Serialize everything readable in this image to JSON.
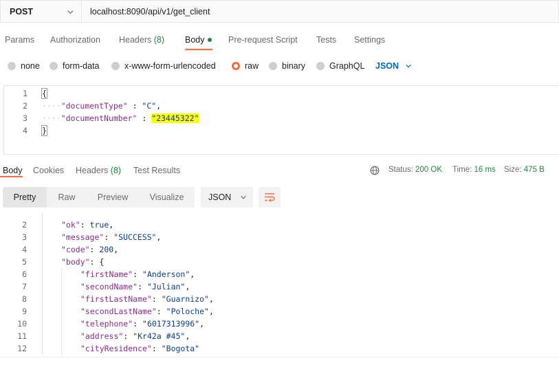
{
  "request": {
    "method": "POST",
    "url": "localhost:8090/api/v1/get_client"
  },
  "request_tabs": [
    {
      "label": "Params"
    },
    {
      "label": "Authorization"
    },
    {
      "label": "Headers",
      "count": "(8)"
    },
    {
      "label": "Body",
      "active": true
    },
    {
      "label": "Pre-request Script"
    },
    {
      "label": "Tests"
    },
    {
      "label": "Settings"
    }
  ],
  "body_types": [
    {
      "label": "none"
    },
    {
      "label": "form-data"
    },
    {
      "label": "x-www-form-urlencoded"
    },
    {
      "label": "raw",
      "checked": true
    },
    {
      "label": "binary"
    },
    {
      "label": "GraphQL"
    }
  ],
  "body_language": "JSON",
  "request_body": {
    "line_numbers": [
      "1",
      "2",
      "3",
      "4"
    ],
    "open": "{",
    "close": "}",
    "entries": [
      {
        "key": "\"documentType\"",
        "sep": " : ",
        "value": "\"C\"",
        "trail": ","
      },
      {
        "key": "\"documentNumber\"",
        "sep": " : ",
        "value": "\"23445322\"",
        "trail": ""
      }
    ]
  },
  "response_tabs": [
    {
      "label": "Body",
      "active": true
    },
    {
      "label": "Cookies"
    },
    {
      "label": "Headers",
      "count": "(8)"
    },
    {
      "label": "Test Results"
    }
  ],
  "response_status": {
    "status_label": "Status:",
    "status_value": "200 OK",
    "time_label": "Time:",
    "time_value": "16 ms",
    "size_label": "Size:",
    "size_value": "475 B"
  },
  "view_modes": [
    {
      "label": "Pretty",
      "active": true
    },
    {
      "label": "Raw"
    },
    {
      "label": "Preview"
    },
    {
      "label": "Visualize"
    }
  ],
  "response_format": "JSON",
  "response_body": {
    "lines": [
      {
        "n": "2",
        "indent": 1,
        "key": "\"ok\"",
        "value": "true",
        "vtype": "kw",
        "trail": ","
      },
      {
        "n": "3",
        "indent": 1,
        "key": "\"message\"",
        "value": "\"SUCCESS\"",
        "vtype": "str",
        "trail": ","
      },
      {
        "n": "4",
        "indent": 1,
        "key": "\"code\"",
        "value": "200",
        "vtype": "num",
        "trail": ","
      },
      {
        "n": "5",
        "indent": 1,
        "key": "\"body\"",
        "value": "{",
        "vtype": "punc",
        "trail": ""
      },
      {
        "n": "6",
        "indent": 2,
        "key": "\"firstName\"",
        "value": "\"Anderson\"",
        "vtype": "str",
        "trail": ","
      },
      {
        "n": "7",
        "indent": 2,
        "key": "\"secondName\"",
        "value": "\"Julian\"",
        "vtype": "str",
        "trail": ","
      },
      {
        "n": "8",
        "indent": 2,
        "key": "\"firstLastName\"",
        "value": "\"Guarnizo\"",
        "vtype": "str",
        "trail": ","
      },
      {
        "n": "9",
        "indent": 2,
        "key": "\"secondLastName\"",
        "value": "\"Poloche\"",
        "vtype": "str",
        "trail": ","
      },
      {
        "n": "10",
        "indent": 2,
        "key": "\"telephone\"",
        "value": "\"6017313996\"",
        "vtype": "str",
        "trail": ","
      },
      {
        "n": "11",
        "indent": 2,
        "key": "\"address\"",
        "value": "\"Kr42a #45\"",
        "vtype": "str",
        "trail": ","
      },
      {
        "n": "12",
        "indent": 2,
        "key": "\"cityResidence\"",
        "value": "\"Bogota\"",
        "vtype": "str",
        "trail": ""
      }
    ]
  },
  "colors": {
    "accent": "#ff6c37",
    "success": "#1b8a3d",
    "link": "#0265d2",
    "highlight": "#ffff00"
  },
  "icons": {
    "method_dropdown": "chevron-down-icon",
    "language_dropdown": "chevron-down-icon",
    "status_globe": "globe-icon",
    "wrap": "wrap-lines-icon"
  }
}
